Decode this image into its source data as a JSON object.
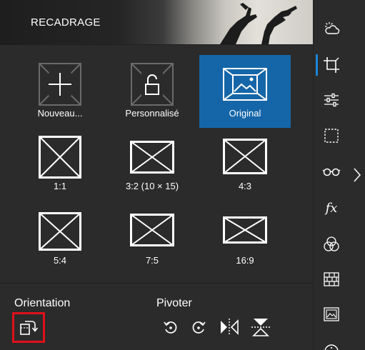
{
  "header": {
    "title": "RECADRAGE"
  },
  "presets": [
    {
      "label": "Nouveau..."
    },
    {
      "label": "Personnalisé"
    },
    {
      "label": "Original"
    },
    {
      "label": "1:1"
    },
    {
      "label": "3:2 (10 × 15)"
    },
    {
      "label": "4:3"
    },
    {
      "label": "5:4"
    },
    {
      "label": "7:5"
    },
    {
      "label": "16:9"
    }
  ],
  "selected_preset": "Original",
  "orientation": {
    "label": "Orientation"
  },
  "rotate": {
    "label": "Pivoter"
  },
  "rail": {
    "active": "crop",
    "icons": [
      "weather-icon",
      "crop-icon",
      "sliders-icon",
      "selection-icon",
      "glasses-icon",
      "fx-icon",
      "color-circles-icon",
      "texture-icon",
      "picture-icon",
      "info-icon"
    ],
    "fx_text": "fx"
  },
  "colors": {
    "accent": "#1566a8",
    "highlight": "#e0101a",
    "active_bar": "#1a86d9"
  }
}
